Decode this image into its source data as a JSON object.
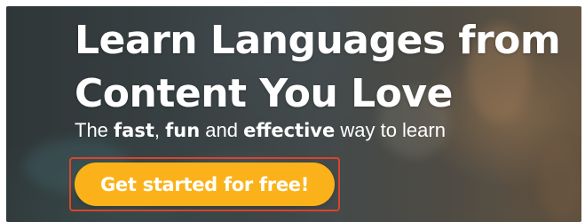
{
  "hero": {
    "headline_line1": "Learn Languages from",
    "headline_line2": "Content You Love",
    "subtitle": {
      "part1": "The ",
      "fast": "fast",
      "part2": ", ",
      "fun": "fun",
      "part3": " and ",
      "effective": "effective",
      "part4": " way to learn"
    },
    "cta_label": "Get started for free!"
  },
  "colors": {
    "cta_background": "#fbb21a",
    "cta_text": "#ffffff",
    "focus_outline": "#d9452b",
    "headline_text": "#ffffff"
  }
}
